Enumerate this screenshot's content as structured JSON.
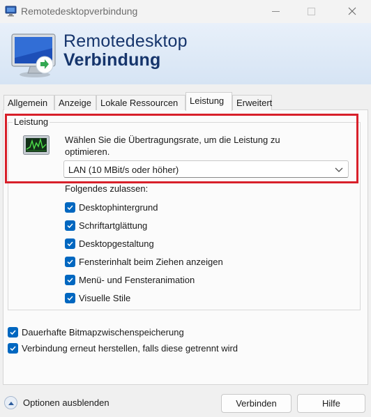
{
  "window": {
    "title": "Remotedesktopverbindung",
    "minimize_icon": "minimize-icon",
    "maximize_icon": "maximize-icon",
    "close_icon": "close-icon"
  },
  "banner": {
    "line1": "Remotedesktop",
    "line2": "Verbindung",
    "icon": "remote-desktop-monitor-icon"
  },
  "tabs": [
    {
      "label": "Allgemein",
      "active": false
    },
    {
      "label": "Anzeige",
      "active": false
    },
    {
      "label": "Lokale Ressourcen",
      "active": false
    },
    {
      "label": "Leistung",
      "active": true
    },
    {
      "label": "Erweitert",
      "active": false
    }
  ],
  "performance": {
    "group_label": "Leistung",
    "description": "Wählen Sie die Übertragungsrate, um die Leistung zu optimieren.",
    "connection_speed": "LAN (10 MBit/s oder höher)",
    "allow_label": "Folgendes zulassen:",
    "options": [
      {
        "label": "Desktophintergrund",
        "checked": true
      },
      {
        "label": "Schriftartglättung",
        "checked": true
      },
      {
        "label": "Desktopgestaltung",
        "checked": true
      },
      {
        "label": "Fensterinhalt beim Ziehen anzeigen",
        "checked": true
      },
      {
        "label": "Menü- und Fensteranimation",
        "checked": true
      },
      {
        "label": "Visuelle Stile",
        "checked": true
      }
    ]
  },
  "extra_options": [
    {
      "label": "Dauerhafte Bitmapzwischenspeicherung",
      "checked": true
    },
    {
      "label": "Verbindung erneut herstellen, falls diese getrennt wird",
      "checked": true
    }
  ],
  "footer": {
    "options_toggle": "Optionen ausblenden",
    "connect_button": "Verbinden",
    "help_button": "Hilfe"
  },
  "colors": {
    "accent": "#0067c0",
    "highlight": "#d8202a",
    "banner_text": "#16356c"
  }
}
